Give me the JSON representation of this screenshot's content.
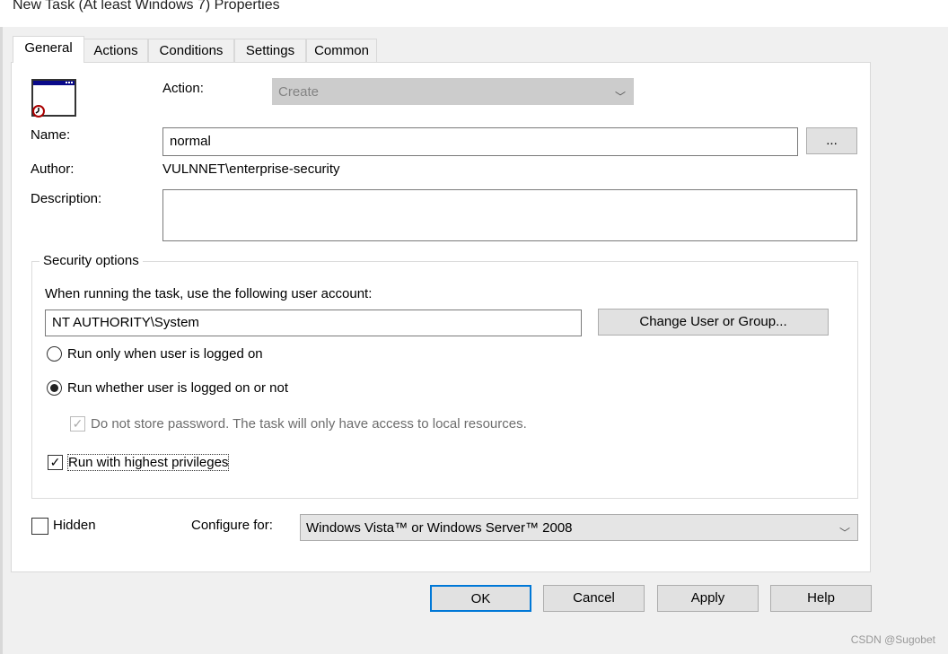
{
  "window": {
    "title": "New Task (At least Windows 7) Properties"
  },
  "tabs": [
    {
      "label": "General",
      "selected": true
    },
    {
      "label": "Actions"
    },
    {
      "label": "Conditions"
    },
    {
      "label": "Settings"
    },
    {
      "label": "Common"
    }
  ],
  "general": {
    "action_label": "Action:",
    "action_value": "Create",
    "name_label": "Name:",
    "name_value": "normal",
    "browse_label": "...",
    "author_label": "Author:",
    "author_value": "VULNNET\\enterprise-security",
    "description_label": "Description:",
    "description_value": "",
    "security": {
      "legend": "Security options",
      "account_prompt": "When running the task, use the following user account:",
      "account_value": "NT AUTHORITY\\System",
      "change_button": "Change User or Group...",
      "radio_logged_on": "Run only when user is logged on",
      "radio_whether": "Run whether user is logged on or not",
      "selected_radio": "Run whether user is logged on or not",
      "no_store_password": "Do not store password. The task will only have access to local resources.",
      "no_store_password_checked": true,
      "no_store_password_enabled": false,
      "highest_privileges": "Run with highest privileges",
      "highest_privileges_checked": true
    },
    "hidden_label": "Hidden",
    "hidden_checked": false,
    "configure_label": "Configure for:",
    "configure_value": "Windows Vista™ or Windows Server™ 2008"
  },
  "buttons": {
    "ok": "OK",
    "cancel": "Cancel",
    "apply": "Apply",
    "help": "Help"
  },
  "watermark": "CSDN @Sugobet",
  "icons": {
    "task": "task-window-clock-icon",
    "chevron": "chevron-down-icon"
  }
}
